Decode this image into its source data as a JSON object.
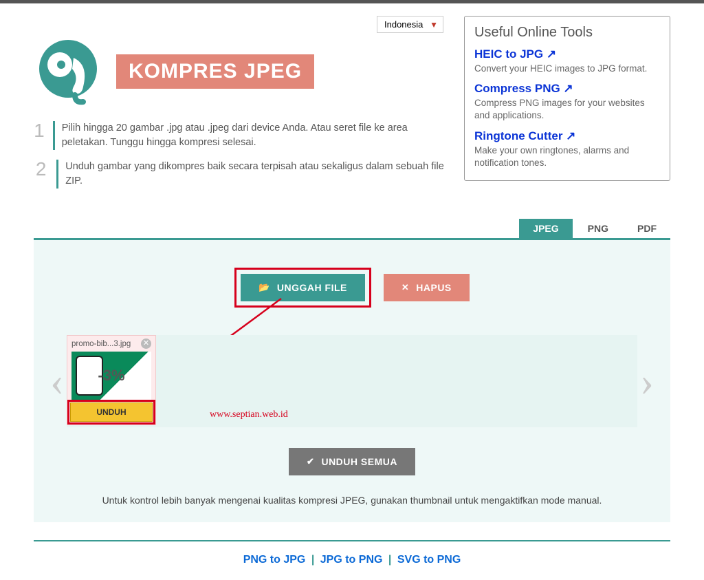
{
  "lang": {
    "selected": "Indonesia"
  },
  "header": {
    "title": "KOMPRES JPEG"
  },
  "steps": {
    "s1": "Pilih hingga 20 gambar .jpg atau .jpeg dari device Anda. Atau seret file ke area peletakan. Tunggu hingga kompresi selesai.",
    "s2": "Unduh gambar yang dikompres baik secara terpisah atau sekaligus dalam sebuah file ZIP."
  },
  "tools": {
    "title": "Useful Online Tools",
    "items": [
      {
        "name": "HEIC to JPG ↗",
        "desc": "Convert your HEIC images to JPG format."
      },
      {
        "name": "Compress PNG ↗",
        "desc": "Compress PNG images for your websites and applications."
      },
      {
        "name": "Ringtone Cutter ↗",
        "desc": "Make your own ringtones, alarms and notification tones."
      }
    ]
  },
  "tabs": {
    "jpeg": "JPEG",
    "png": "PNG",
    "pdf": "PDF"
  },
  "buttons": {
    "upload": "UNGGAH FILE",
    "clear": "HAPUS",
    "download_all": "UNDUH SEMUA",
    "download": "UNDUH"
  },
  "file": {
    "name": "promo-bib...3.jpg",
    "reduction": "-3%"
  },
  "watermark": "www.septian.web.id",
  "note": "Untuk kontrol lebih banyak mengenai kualitas kompresi JPEG, gunakan thumbnail untuk mengaktifkan mode manual.",
  "footer": {
    "l1": "PNG to JPG",
    "l2": "JPG to PNG",
    "l3": "SVG to PNG"
  },
  "colors": {
    "accent": "#3a9a92",
    "warn": "#e28779",
    "highlight": "#d6001c"
  }
}
